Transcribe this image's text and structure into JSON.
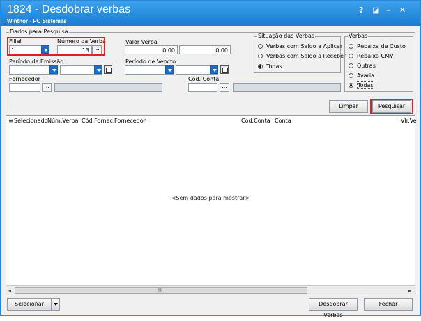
{
  "window": {
    "title": "1824 - Desdobrar verbas",
    "subtitle": "Winthor - PC Sistemas",
    "controls": {
      "help": "?",
      "restore": "◪",
      "minimize": "–",
      "close": "✕"
    }
  },
  "search_panel": {
    "group_label": "Dados para Pesquisa",
    "filial_label": "Filial",
    "filial_value": "1",
    "numero_verba_label": "Número da Verba",
    "numero_verba_value": "13",
    "valor_verba_label": "Valor Verba",
    "valor_min": "0,00",
    "valor_max": "0,00",
    "periodo_emissao_label": "Período de Emissão",
    "periodo_emissao_start": "",
    "periodo_emissao_end": "",
    "periodo_vencto_label": "Período de Vencto",
    "periodo_vencto_start": "",
    "periodo_vencto_end": "",
    "fornecedor_label": "Fornecedor",
    "fornecedor_code": "",
    "fornecedor_name": "",
    "cod_conta_label": "Cód. Conta",
    "cod_conta_code": "",
    "cod_conta_name": "",
    "ellipsis": "...",
    "situacao": {
      "label": "Situação das Verbas",
      "options": [
        "Verbas com Saldo a Aplicar",
        "Verbas com Saldo a Receber",
        "Todas"
      ],
      "selected": "Todas"
    },
    "verbas": {
      "label": "Verbas",
      "options": [
        "Rebaixa de Custo",
        "Rebaixa CMV",
        "Outras",
        "Avaria",
        "Todas"
      ],
      "selected": "Todas"
    },
    "limpar_label": "Limpar",
    "pesquisar_label": "Pesquisar"
  },
  "grid": {
    "columns": [
      "Selecionado",
      "Núm.Verba",
      "Cód.Fornec.",
      "Fornecedor",
      "Cód.Conta",
      "Conta",
      "Vlr.Ve"
    ],
    "empty_text": "<Sem dados para mostrar>",
    "scroll_grip": "III",
    "arrow_left": "◂",
    "arrow_right": "▸"
  },
  "footer": {
    "selecionar_label": "Selecionar",
    "desdobrar_label": "Desdobrar Verbas",
    "fechar_label": "Fechar"
  },
  "highlight_color": "#e02020",
  "accent_color": "#1f6fc6"
}
